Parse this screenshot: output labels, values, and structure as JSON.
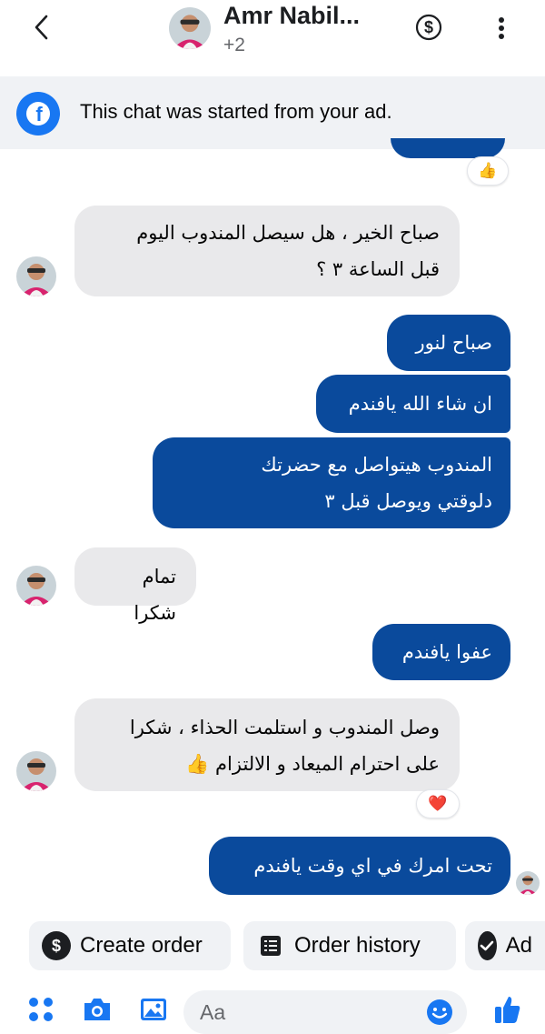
{
  "header": {
    "name": "Amr Nabil...",
    "participants_extra": "+2"
  },
  "banner": {
    "text": "This chat was started from your ad."
  },
  "messages": [
    {
      "from": "customer",
      "text_line1": "صباح الخير ، هل سيصل المندوب اليوم",
      "text_line2": "قبل الساعة ٣ ؟"
    },
    {
      "from": "page",
      "text": "صباح لنور"
    },
    {
      "from": "page",
      "text": "ان شاء الله يافندم"
    },
    {
      "from": "page",
      "text_line1": "المندوب هيتواصل مع حضرتك",
      "text_line2": "دلوقتي ويوصل قبل ٣"
    },
    {
      "from": "customer",
      "text": "تمام شكرا"
    },
    {
      "from": "page",
      "text": "عفوا يافندم"
    },
    {
      "from": "customer",
      "text_line1": "وصل المندوب  و استلمت الحذاء ، شكرا",
      "text_line2": "على احترام الميعاد و الالتزام 👍"
    },
    {
      "from": "page",
      "text": "تحت امرك في اي وقت يافندم"
    }
  ],
  "reactions": {
    "top": "👍",
    "customer_last": "❤️"
  },
  "quick_replies": [
    {
      "label": "Create order",
      "icon": "dollar-circle-icon"
    },
    {
      "label": "Order history",
      "icon": "list-icon"
    },
    {
      "label": "Ad",
      "icon": "check-circle-icon"
    }
  ],
  "composer": {
    "placeholder": "Aa"
  },
  "colors": {
    "outgoing_bubble": "#0a4a9c",
    "incoming_bubble": "#e9e9eb",
    "accent": "#1877f2"
  }
}
